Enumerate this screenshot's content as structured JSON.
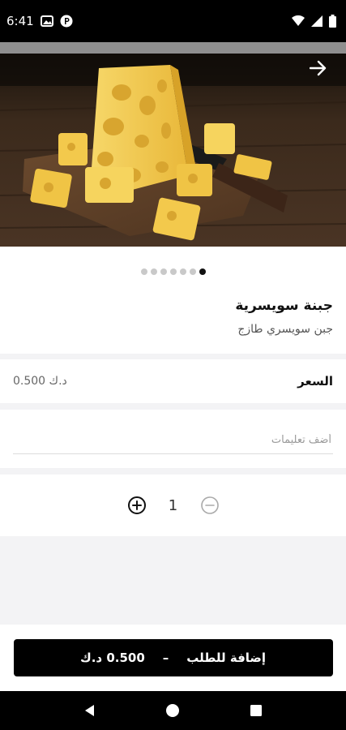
{
  "status_bar": {
    "time": "6:41",
    "icons": [
      "gallery-icon",
      "p-badge-icon",
      "wifi-icon",
      "signal-icon",
      "battery-icon"
    ]
  },
  "hero": {
    "image": "swiss-cheese-photo",
    "back_icon": "arrow-right-icon"
  },
  "carousel": {
    "total": 7,
    "active_index": 6
  },
  "product": {
    "name": "جبنة سويسرية",
    "description": "جبن سويسري طازج"
  },
  "price": {
    "label": "السعر",
    "value": "0.500 د.ك"
  },
  "notes": {
    "placeholder": "أضف تعليمات",
    "value": ""
  },
  "quantity": {
    "value": "1",
    "plus_icon": "plus-circle-icon",
    "minus_icon": "minus-circle-icon"
  },
  "add_button": {
    "label": "إضافة للطلب",
    "separator": "–",
    "price": "0.500 د.ك"
  },
  "nav": {
    "icons": [
      "back-triangle-icon",
      "home-circle-icon",
      "recents-square-icon"
    ]
  },
  "colors": {
    "primary": "#000000",
    "background": "#f3f3f5",
    "cheese": "#f3c94c"
  }
}
